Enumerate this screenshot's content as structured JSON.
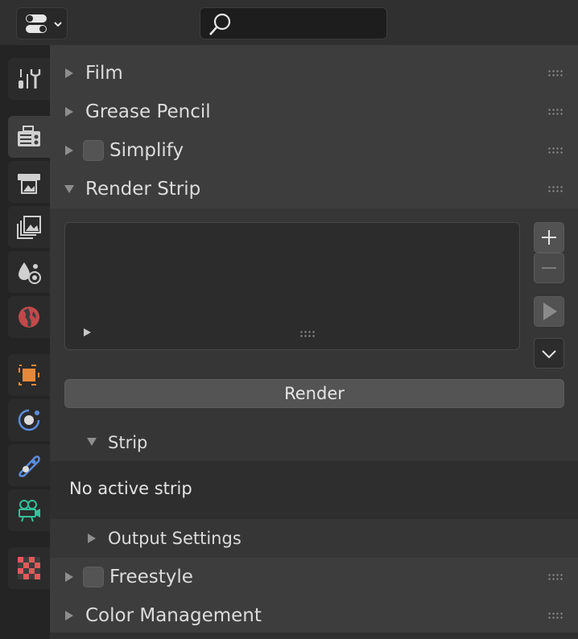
{
  "header": {
    "editor_type_icon": "editor-type-icon",
    "search_icon": "search-icon",
    "search_value": ""
  },
  "tabs": [
    {
      "name": "tool",
      "icon": "tool-icon",
      "color": "#d0d0d0"
    },
    {
      "name": "render",
      "icon": "render-icon",
      "color": "#d0d0d0",
      "active": true
    },
    {
      "name": "output",
      "icon": "output-icon",
      "color": "#d0d0d0"
    },
    {
      "name": "view-layer",
      "icon": "view-layer-icon",
      "color": "#d0d0d0"
    },
    {
      "name": "scene",
      "icon": "scene-icon",
      "color": "#d0d0d0"
    },
    {
      "name": "world",
      "icon": "world-icon",
      "color": "#e05a5a"
    },
    {
      "name": "object",
      "icon": "object-icon",
      "color": "#e8893a"
    },
    {
      "name": "physics",
      "icon": "physics-icon",
      "color": "#5b8ddd"
    },
    {
      "name": "constraints",
      "icon": "constraints-icon",
      "color": "#5b8ddd"
    },
    {
      "name": "camera-data",
      "icon": "camera-data-icon",
      "color": "#35c09a"
    },
    {
      "name": "texture",
      "icon": "texture-icon",
      "color": "#e05a5a"
    }
  ],
  "panels": {
    "film": "Film",
    "grease_pencil": "Grease Pencil",
    "simplify": "Simplify",
    "render_strip": "Render Strip",
    "freestyle": "Freestyle",
    "color_management": "Color Management"
  },
  "render_strip": {
    "render_button": "Render",
    "add_icon": "plus-icon",
    "remove_icon": "minus-icon",
    "play_icon": "play-icon",
    "menu_icon": "chevron-down-icon",
    "strip_label": "Strip",
    "no_active": "No active strip",
    "output_settings": "Output Settings"
  }
}
